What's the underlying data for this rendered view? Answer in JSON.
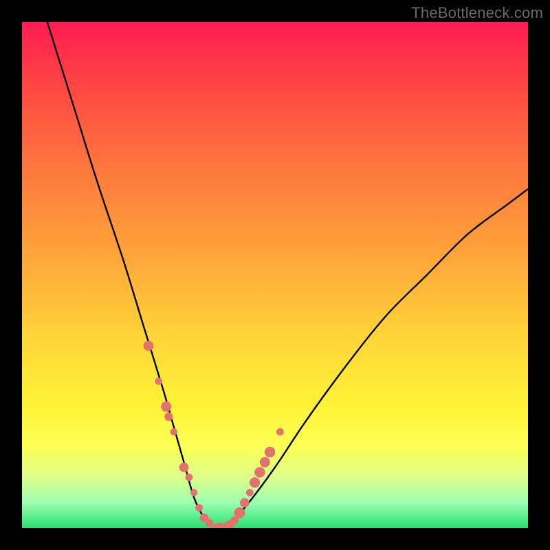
{
  "watermark": "TheBottleneck.com",
  "chart_data": {
    "type": "line",
    "title": "",
    "xlabel": "",
    "ylabel": "",
    "xlim": [
      0,
      100
    ],
    "ylim": [
      0,
      100
    ],
    "series": [
      {
        "name": "bottleneck-curve",
        "x": [
          5,
          10,
          15,
          20,
          24,
          28,
          30,
          32,
          34,
          36,
          38,
          40,
          44,
          50,
          56,
          64,
          72,
          80,
          88,
          96,
          100
        ],
        "values": [
          100,
          84,
          68,
          53,
          40,
          27,
          20,
          13,
          6,
          2,
          0,
          0,
          4,
          12,
          21,
          32,
          42,
          50,
          58,
          64,
          67
        ]
      }
    ],
    "markers": {
      "name": "highlight-dots",
      "color": "#e3716e",
      "x": [
        25,
        27,
        28.5,
        29,
        30,
        32,
        33,
        34,
        35,
        36,
        37,
        38,
        39,
        40,
        41,
        42,
        43,
        44,
        45,
        46,
        47,
        48,
        49,
        51
      ],
      "values": [
        36,
        29,
        24,
        22,
        19,
        12,
        10,
        7,
        4,
        2,
        1,
        0,
        0,
        0,
        0.5,
        1.5,
        3,
        5,
        7,
        9,
        11,
        13,
        15,
        19
      ]
    },
    "gradient_stops": [
      {
        "pos": 0,
        "color": "#ff1b54"
      },
      {
        "pos": 50,
        "color": "#ffc338"
      },
      {
        "pos": 85,
        "color": "#fcff4a"
      },
      {
        "pos": 100,
        "color": "#28e06e"
      }
    ]
  }
}
